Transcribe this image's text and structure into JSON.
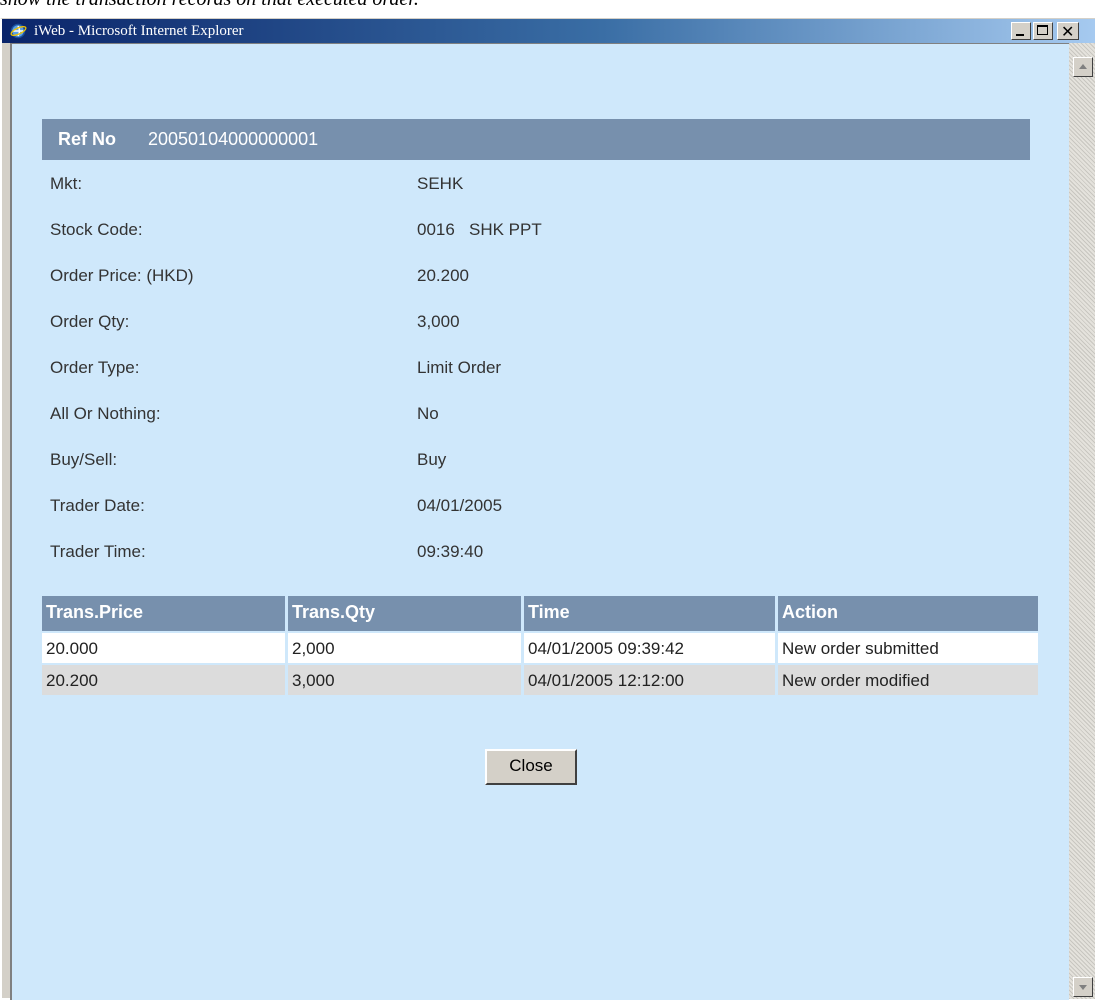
{
  "document": {
    "caption": "show the transaction records on that executed order."
  },
  "window": {
    "title": "iWeb - Microsoft Internet Explorer"
  },
  "order": {
    "ref_label": "Ref No",
    "ref_value": "20050104000000001",
    "fields": [
      {
        "label": "Mkt:",
        "value": "SEHK"
      },
      {
        "label": "Stock Code:",
        "value": "0016   SHK PPT"
      },
      {
        "label": "Order Price: (HKD)",
        "value": "20.200"
      },
      {
        "label": "Order Qty:",
        "value": "3,000"
      },
      {
        "label": "Order Type:",
        "value": "Limit Order"
      },
      {
        "label": "All Or Nothing:",
        "value": "No"
      },
      {
        "label": "Buy/Sell:",
        "value": "Buy"
      },
      {
        "label": "Trader Date:",
        "value": "04/01/2005"
      },
      {
        "label": "Trader Time:",
        "value": "09:39:40"
      }
    ]
  },
  "transactions": {
    "headers": [
      "Trans.Price",
      "Trans.Qty",
      "Time",
      "Action"
    ],
    "rows": [
      [
        "20.000",
        "2,000",
        "04/01/2005 09:39:42",
        "New order submitted"
      ],
      [
        "20.200",
        "3,000",
        "04/01/2005 12:12:00",
        "New order modified"
      ]
    ]
  },
  "actions": {
    "close_label": "Close"
  },
  "colors": {
    "header_bar": "#7790ad",
    "content_bg": "#cfe8fb",
    "row_alt": "#dcdcdc"
  },
  "icons": [
    "ie-icon",
    "minimize-icon",
    "maximize-icon",
    "close-icon",
    "scroll-up-icon",
    "scroll-down-icon"
  ]
}
